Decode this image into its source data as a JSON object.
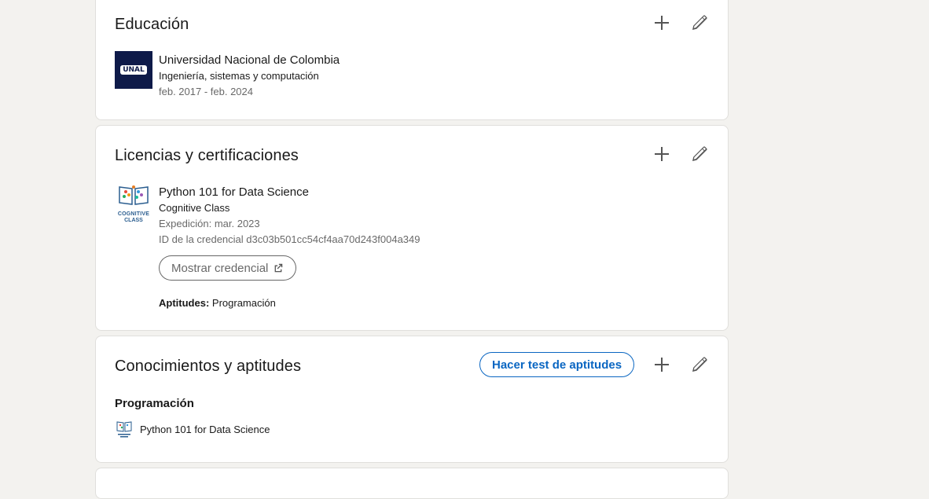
{
  "colors": {
    "page_bg": "#f3f2ef",
    "card_bg": "#ffffff",
    "accent": "#0a66c2",
    "unal_logo_bg": "#0e1a49"
  },
  "education": {
    "title": "Educación",
    "add_icon": "plus-icon",
    "edit_icon": "pencil-icon",
    "entry": {
      "logo_text": "UNAL",
      "school": "Universidad Nacional de Colombia",
      "degree": "Ingeniería, sistemas y computación",
      "dates": "feb. 2017 - feb. 2024"
    }
  },
  "certifications": {
    "title": "Licencias y certificaciones",
    "add_icon": "plus-icon",
    "edit_icon": "pencil-icon",
    "entry": {
      "logo_text_1": "COGNITIVE",
      "logo_text_2": "CLASS",
      "name": "Python 101 for Data Science",
      "issuer": "Cognitive Class",
      "issued": "Expedición: mar. 2023",
      "credential_id": "ID de la credencial d3c03b501cc54cf4aa70d243f004a349",
      "show_credential_label": "Mostrar credencial",
      "external_link_icon": "external-link-icon",
      "skills_label": "Aptitudes:",
      "skills_value": "Programación"
    }
  },
  "skills": {
    "title": "Conocimientos y aptitudes",
    "test_button_label": "Hacer test de aptitudes",
    "add_icon": "plus-icon",
    "edit_icon": "pencil-icon",
    "items": [
      {
        "name": "Programación",
        "source": "Python 101 for Data Science"
      }
    ]
  }
}
